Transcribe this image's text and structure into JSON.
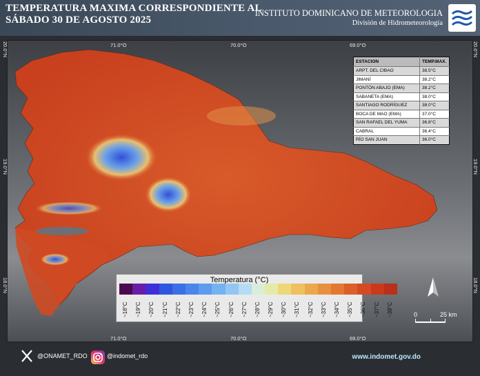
{
  "header": {
    "title_line1": "TEMPERATURA MAXIMA CORRESPONDIENTE AL",
    "title_line2": "SÁBADO 30 DE AGOSTO 2025",
    "institution": "INSTITUTO DOMINICANO DE METEOROLOGIA",
    "division": "División de Hidrometeorología",
    "logo_icon": "indomet-logo-icon"
  },
  "map": {
    "coords_top": [
      "71.0°O",
      "70.0°O",
      "69.0°O"
    ],
    "coords_bottom": [
      "71.0°O",
      "70.0°O",
      "69.0°O"
    ],
    "coords_left": [
      "20.0°N",
      "19.0°N",
      "18.0°N"
    ],
    "coords_right": [
      "20.0°N",
      "19.0°N",
      "18.0°N"
    ],
    "north_icon": "north-arrow-icon",
    "scale_zero": "0",
    "scale_label": "25 km"
  },
  "stations": {
    "header_station": "ESTACION",
    "header_temp": "TEMP.MAX.",
    "rows": [
      {
        "name": "ARPT. DEL CIBAO",
        "temp": "38.5°C"
      },
      {
        "name": "JIMANÍ",
        "temp": "38.2°C"
      },
      {
        "name": "PONTÓN ABAJO (EMA)",
        "temp": "38.2°C"
      },
      {
        "name": "SABANETA (EMA)",
        "temp": "38.0°C"
      },
      {
        "name": "SANTIAGO RODRÍGUEZ",
        "temp": "38.0°C"
      },
      {
        "name": "BOCA DE MAO (EMA)",
        "temp": "37.0°C"
      },
      {
        "name": "SAN RAFAEL DEL YUMA",
        "temp": "36.8°C"
      },
      {
        "name": "CABRAL",
        "temp": "36.4°C"
      },
      {
        "name": "RÍO SAN JUAN",
        "temp": "36.0°C"
      }
    ]
  },
  "legend": {
    "title": "Temperatura (°C)",
    "labels": [
      "~18°C",
      "~19°C",
      "~20°C",
      "~21°C",
      "~22°C",
      "~23°C",
      "~24°C",
      "~25°C",
      "~26°C",
      "~27°C",
      "~28°C",
      "~29°C",
      "~30°C",
      "~31°C",
      "~32°C",
      "~33°C",
      "~34°C",
      "~35°C",
      "~36°C",
      "~37°C",
      "~38°C"
    ],
    "colors": [
      "#4b0a4f",
      "#6a1ea8",
      "#3f2fd8",
      "#2f56e0",
      "#3b6fe6",
      "#4a86ea",
      "#5d9cec",
      "#76b2f0",
      "#93c6f2",
      "#b5dcf4",
      "#d9eed8",
      "#e6eaa8",
      "#eed77a",
      "#eec060",
      "#eba84c",
      "#e79040",
      "#e27834",
      "#dc5f2a",
      "#d54a22",
      "#c93a1c",
      "#b8301a"
    ]
  },
  "footer": {
    "x_icon": "x-logo-icon",
    "x_handle": "@ONAMET_RDO",
    "instagram_icon": "instagram-icon",
    "instagram_handle": "@indomet_rdo",
    "website": "www.indomet.gov.do"
  }
}
